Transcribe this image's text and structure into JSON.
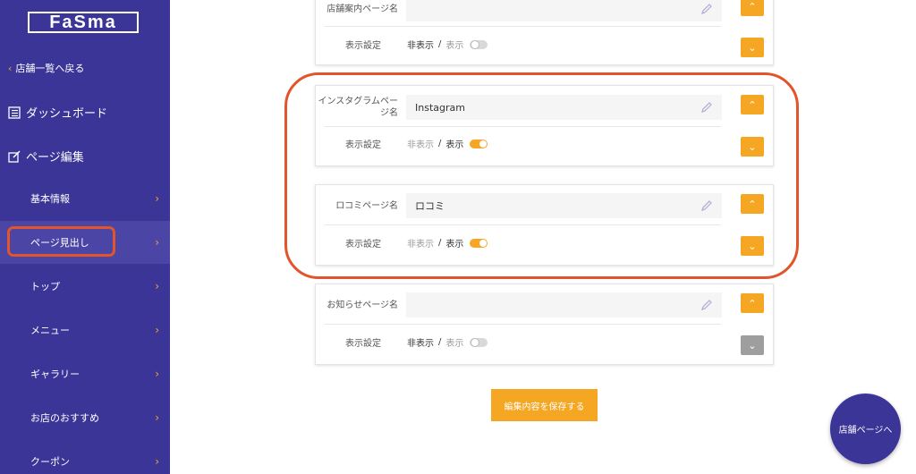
{
  "sidebar": {
    "logo": "FaSma",
    "back_label": "店舗一覧へ戻る",
    "dashboard_label": "ダッシュボード",
    "page_edit_label": "ページ編集",
    "items": [
      {
        "label": "基本情報"
      },
      {
        "label": "ページ見出し"
      },
      {
        "label": "トップ"
      },
      {
        "label": "メニュー"
      },
      {
        "label": "ギャラリー"
      },
      {
        "label": "お店のおすすめ"
      },
      {
        "label": "クーポン"
      }
    ]
  },
  "sections": [
    {
      "label": "店舗案内ページ名",
      "value": "",
      "display_label": "表示設定",
      "hidden": "非表示",
      "shown": "表示",
      "state": "off"
    },
    {
      "label": "インスタグラムページ名",
      "value": "Instagram",
      "display_label": "表示設定",
      "hidden": "非表示",
      "shown": "表示",
      "state": "on"
    },
    {
      "label": "ロコミページ名",
      "value": "ロコミ",
      "display_label": "表示設定",
      "hidden": "非表示",
      "shown": "表示",
      "state": "on"
    },
    {
      "label": "お知らせページ名",
      "value": "",
      "display_label": "表示設定",
      "hidden": "非表示",
      "shown": "表示",
      "state": "off"
    }
  ],
  "save_label": "編集内容を保存する",
  "store_page_label": "店舗ページへ",
  "colors": {
    "sidebar": "#3a3597",
    "accent": "#f5a623",
    "highlight": "#e2542b"
  }
}
